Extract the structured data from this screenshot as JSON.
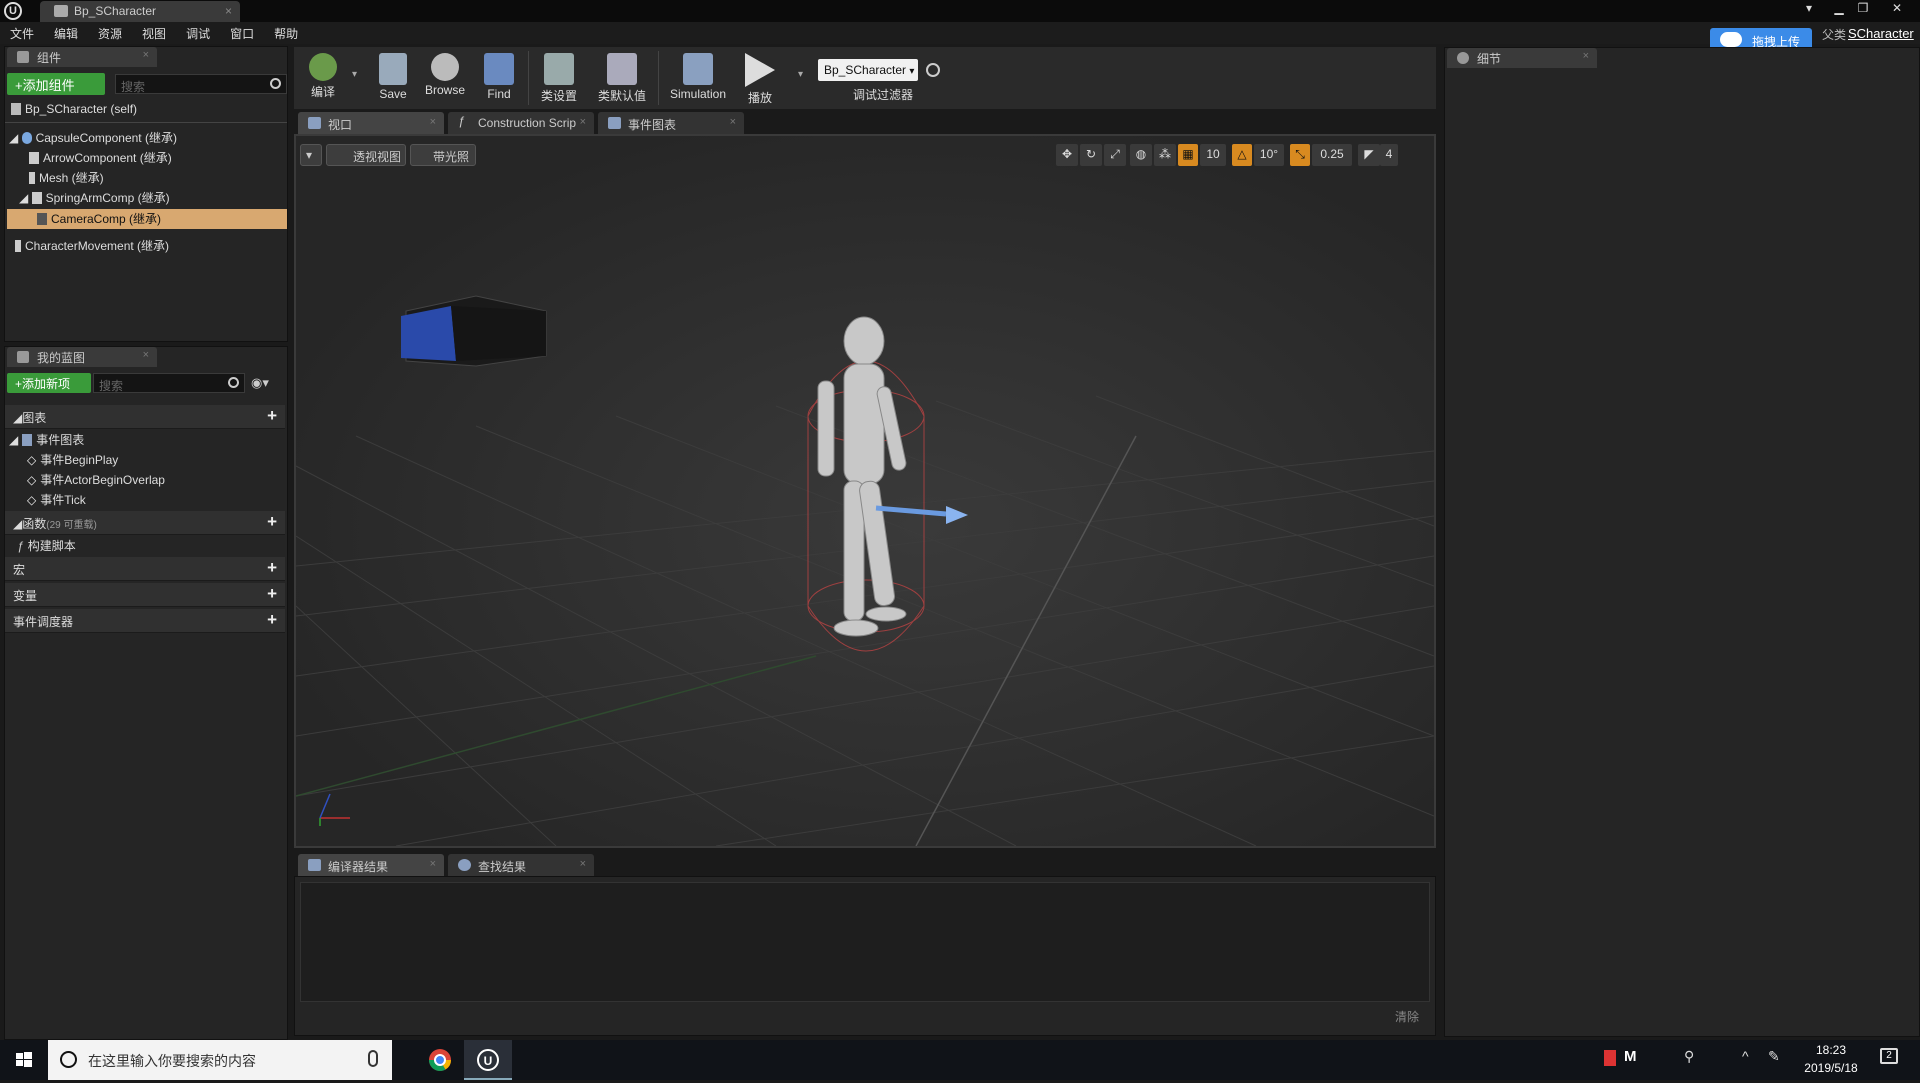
{
  "titlebar": {
    "tab_title": "Bp_SCharacter"
  },
  "menubar": {
    "items": [
      "文件",
      "编辑",
      "资源",
      "视图",
      "调试",
      "窗口",
      "帮助"
    ]
  },
  "upload_button": "拖拽上传",
  "parent": {
    "label": "父类",
    "link": "SCharacter"
  },
  "components_panel": {
    "tab": "组件",
    "add_button": "+添加组件",
    "search_placeholder": "搜索",
    "self_row": "Bp_SCharacter (self)",
    "items": [
      "CapsuleComponent (继承)",
      "ArrowComponent (继承)",
      "Mesh (继承)",
      "SpringArmComp (继承)",
      "CameraComp (继承)",
      "CharacterMovement (继承)"
    ]
  },
  "my_blueprint_panel": {
    "tab": "我的蓝图",
    "add_button": "+添加新项",
    "search_placeholder": "搜索",
    "graphs_section": "图表",
    "event_graph": "事件图表",
    "events": [
      "事件BeginPlay",
      "事件ActorBeginOverlap",
      "事件Tick"
    ],
    "functions_section": "函数",
    "functions_count": "(29 可重载)",
    "construct_script": "构建脚本",
    "macros_section": "宏",
    "variables_section": "变量",
    "dispatchers_section": "事件调度器"
  },
  "toolbar": {
    "compile": "编译",
    "save": "Save",
    "browse": "Browse",
    "find": "Find",
    "class_settings": "类设置",
    "class_defaults": "类默认值",
    "simulation": "Simulation",
    "play": "播放",
    "debug_object": "Bp_SCharacter",
    "debug_filter": "调试过滤器"
  },
  "viewport_tabs": [
    "视口",
    "Construction Scrip",
    "事件图表"
  ],
  "viewport": {
    "perspective": "透视视图",
    "lit": "带光照",
    "grid_snap": "10",
    "rotation_snap": "10°",
    "scale_snap": "0.25",
    "camera_speed": "4"
  },
  "bottom_tabs": [
    "编译器结果",
    "查找结果"
  ],
  "bottom_clear": "清除",
  "details_panel": {
    "tab": "细节"
  },
  "taskbar": {
    "search_placeholder": "在这里输入你要搜索的内容",
    "time": "18:23",
    "date": "2019/5/18",
    "notification_count": "2"
  },
  "colors": {
    "accent_green": "#3a9b3a",
    "selection": "#d8a870",
    "upload_blue": "#3b8be8"
  }
}
